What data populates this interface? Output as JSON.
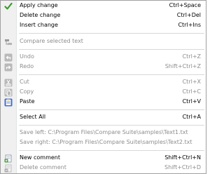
{
  "menu": {
    "apply": {
      "label": "Apply change",
      "shortcut": "Ctrl+Space",
      "icon": "check-icon"
    },
    "delete": {
      "label": "Delete change",
      "shortcut": "Ctrl+Del"
    },
    "insert": {
      "label": "Insert change",
      "shortcut": "Ctrl+Ins"
    },
    "compare_selected": {
      "label": "Compare selected text",
      "icon": "compare-icon"
    },
    "undo": {
      "label": "Undo",
      "shortcut": "Ctrl+Z",
      "icon": "undo-icon"
    },
    "redo": {
      "label": "Redo",
      "shortcut": "Shift+Ctrl+Z",
      "icon": "redo-icon"
    },
    "cut": {
      "label": "Cut",
      "shortcut": "Ctrl+X",
      "icon": "scissors-icon"
    },
    "copy": {
      "label": "Copy",
      "shortcut": "Ctrl+C",
      "icon": "copy-icon"
    },
    "paste": {
      "label": "Paste",
      "shortcut": "Ctrl+V",
      "icon": "paste-icon"
    },
    "select_all": {
      "label": "Select All",
      "shortcut": "Ctrl+A"
    },
    "save_left": {
      "label": "Save left: C:\\Program Files\\Compare Suite\\samples\\Text1.txt"
    },
    "save_right": {
      "label": "Save right: C:\\Program Files\\Compare Suite\\samples\\Text2.txt"
    },
    "new_comment": {
      "label": "New comment",
      "shortcut": "Shift+Ctrl+N",
      "icon": "add-comment-icon"
    },
    "delete_comment": {
      "label": "Delete comment",
      "shortcut": "Shift+Ctrl+D",
      "icon": "delete-comment-icon"
    }
  },
  "colors": {
    "check": "#3a9a2c",
    "disabled_text": "#8d8d8d",
    "gutter": "#f0f0f0",
    "paste_blue": "#3f6fd0"
  }
}
